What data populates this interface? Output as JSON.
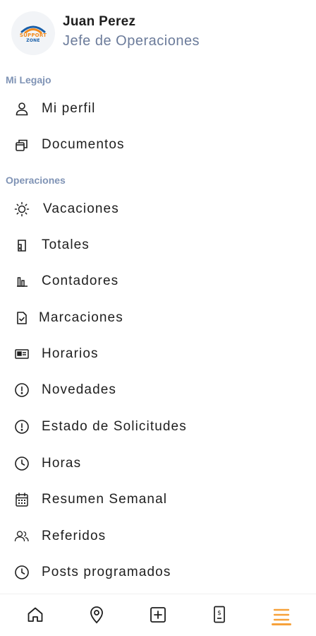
{
  "user": {
    "logo_line1": "SUPPORT",
    "logo_line2": "ZONE",
    "name": "Juan Perez",
    "role": "Jefe de Operaciones"
  },
  "sections": {
    "legajo_title": "Mi Legajo",
    "operaciones_title": "Operaciones"
  },
  "menu": {
    "perfil": {
      "label": "Mi perfil",
      "icon": "user-icon"
    },
    "documentos": {
      "label": "Documentos",
      "icon": "documents-icon"
    },
    "vacaciones": {
      "label": "Vacaciones",
      "icon": "sun-icon"
    },
    "totales": {
      "label": "Totales",
      "icon": "totals-icon"
    },
    "contadores": {
      "label": "Contadores",
      "icon": "bar-chart-icon"
    },
    "marcaciones": {
      "label": "Marcaciones",
      "icon": "file-check-icon"
    },
    "horarios": {
      "label": "Horarios",
      "icon": "id-card-icon"
    },
    "novedades": {
      "label": "Novedades",
      "icon": "alert-circle-icon"
    },
    "estado_solicitudes": {
      "label": "Estado de Solicitudes",
      "icon": "alert-circle-icon"
    },
    "horas": {
      "label": "Horas",
      "icon": "clock-icon"
    },
    "resumen_semanal": {
      "label": "Resumen Semanal",
      "icon": "calendar-icon"
    },
    "referidos": {
      "label": "Referidos",
      "icon": "users-icon"
    },
    "posts_programados": {
      "label": "Posts programados",
      "icon": "clock-icon"
    }
  },
  "bottom_nav": {
    "items": [
      "home-icon",
      "location-pin-icon",
      "plus-square-icon",
      "payslip-icon",
      "menu-icon"
    ],
    "active": "menu-icon",
    "active_color": "#f7a13a"
  },
  "colors": {
    "section_title": "#7f93b5",
    "role_text": "#6b7b9a",
    "text": "#1e1e1e"
  }
}
